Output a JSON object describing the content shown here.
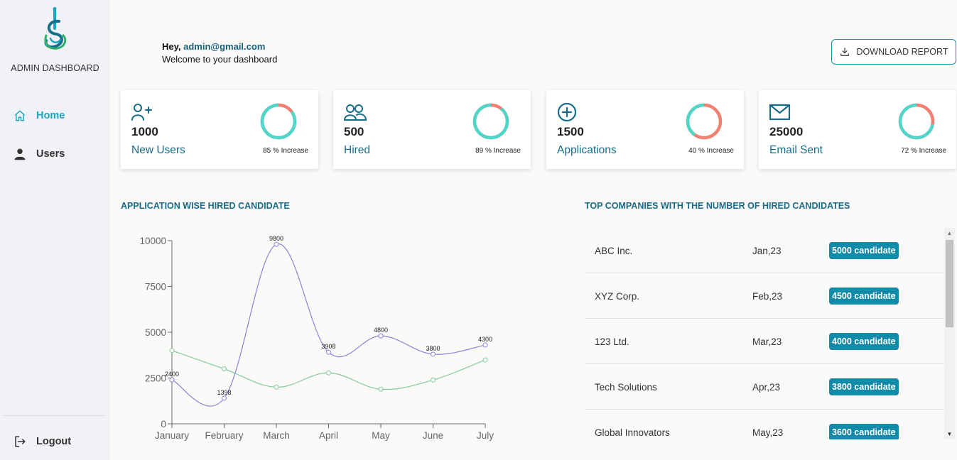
{
  "sidebar": {
    "brand": "ADMIN DASHBOARD",
    "items": [
      {
        "label": "Home",
        "icon": "home-icon",
        "active": true
      },
      {
        "label": "Users",
        "icon": "user-icon",
        "active": false
      }
    ],
    "logout": {
      "label": "Logout",
      "icon": "logout-icon"
    }
  },
  "header": {
    "hey": "Hey,",
    "email": "admin@gmail.com",
    "welcome": "Welcome to your dashboard",
    "download_label": "DOWNLOAD REPORT"
  },
  "cards": [
    {
      "value": "1000",
      "label": "New Users",
      "increase": "85 % Increase",
      "icon": "user-plus-icon",
      "percent": 85
    },
    {
      "value": "500",
      "label": "Hired",
      "increase": "89 % Increase",
      "icon": "users-icon",
      "percent": 89
    },
    {
      "value": "1500",
      "label": "Applications",
      "increase": "40 % Increase",
      "icon": "plus-circle-icon",
      "percent": 40
    },
    {
      "value": "25000",
      "label": "Email Sent",
      "increase": "72 % Increase",
      "icon": "mail-icon",
      "percent": 72
    }
  ],
  "colors": {
    "accent": "#1aa6c0",
    "heading": "#176c8a",
    "donut_fill": "#4fd6c8",
    "donut_rest": "#f08071",
    "badge": "#128aaa",
    "series_1": "#8884d8",
    "series_2": "#82ca9d"
  },
  "chart_title": "APPLICATION WISE HIRED CANDIDATE",
  "chart_data": {
    "type": "line",
    "x": [
      "January",
      "February",
      "March",
      "April",
      "May",
      "June",
      "July"
    ],
    "series": [
      {
        "values": [
          2400,
          1398,
          9800,
          3908,
          4800,
          3800,
          4300
        ],
        "labeled": true,
        "color": "#8884d8"
      },
      {
        "values": [
          4000,
          3000,
          2000,
          2780,
          1890,
          2390,
          3490
        ],
        "labeled": false,
        "color": "#82ca9d"
      }
    ],
    "yticks": [
      0,
      2500,
      5000,
      7500,
      10000
    ],
    "ylim": [
      0,
      10000
    ],
    "grid": false,
    "legend": false
  },
  "companies_title": "TOP COMPANIES WITH THE NUMBER OF HIRED CANDIDATES",
  "companies": [
    {
      "name": "ABC Inc.",
      "date": "Jan,23",
      "badge": "5000 candidate"
    },
    {
      "name": "XYZ Corp.",
      "date": "Feb,23",
      "badge": "4500 candidate"
    },
    {
      "name": "123 Ltd.",
      "date": "Mar,23",
      "badge": "4000 candidate"
    },
    {
      "name": "Tech Solutions",
      "date": "Apr,23",
      "badge": "3800 candidate"
    },
    {
      "name": "Global Innovators",
      "date": "May,23",
      "badge": "3600 candidate"
    }
  ]
}
